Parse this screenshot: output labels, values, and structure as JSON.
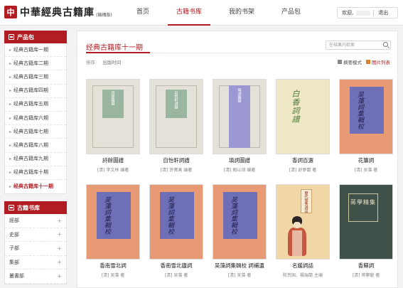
{
  "header": {
    "logo_mark": "中",
    "logo_text": "中華經典古籍庫",
    "logo_sub": "(機構版)",
    "nav": [
      "首页",
      "古籍书库",
      "我的书架",
      "产品包"
    ],
    "active_nav": 1,
    "welcome": "欢迎,",
    "logout": "退出"
  },
  "sidebar": {
    "products_title": "产品包",
    "products": [
      "经典古籍库一期",
      "经典古籍库二期",
      "经典古籍库三期",
      "经典古籍库四期",
      "经典古籍库五期",
      "经典古籍库六期",
      "经典古籍库七期",
      "经典古籍库八期",
      "经典古籍库九期",
      "经典古籍库十期",
      "经典古籍库十一期"
    ],
    "active_product": 10,
    "library_title": "古籍书库",
    "categories": [
      "經部",
      "史部",
      "子部",
      "集部",
      "叢書部"
    ]
  },
  "main": {
    "title": "经典古籍库十一期",
    "search_placeholder": "在结果内检索",
    "sort_label": "排序:",
    "sort_option": "出版时间",
    "view_summary": "摘要模式",
    "view_grid": "图片列表"
  },
  "books": [
    {
      "title": "詩餘圖譜",
      "author": "[清] 李文林 编著",
      "cover": "green",
      "cover_text": "詩餘圖譜"
    },
    {
      "title": "自怡軒詞譜",
      "author": "[清] 許寶善 编著",
      "cover": "green",
      "cover_text": "自怡軒詞譜"
    },
    {
      "title": "填詞圖譜",
      "author": "[清] 賴以邠 编著",
      "cover": "purple",
      "cover_text": "填詞圖譜"
    },
    {
      "title": "香詞百選",
      "author": "[清] 舒夢蘭 著",
      "cover": "calli",
      "cover_text": "白香詞譜"
    },
    {
      "title": "花簾詞",
      "author": "[清] 吴藻 著",
      "cover": "orange",
      "cover_text": "吴藻詞集輯校"
    },
    {
      "title": "香南雪北詞",
      "author": "[清] 吴藻 著",
      "cover": "orange",
      "cover_text": "吴藻詞集輯校"
    },
    {
      "title": "香南雪北廬詞",
      "author": "[清] 吴藻 著",
      "cover": "orange",
      "cover_text": "吴藻詞集輯校"
    },
    {
      "title": "吴藻詞集輯校 詞補遺",
      "author": "[清] 吴藻 著",
      "cover": "orange",
      "cover_text": "吴藻詞集輯校"
    },
    {
      "title": "名媛詞話",
      "author": "陈荒国、楊瑞蘭 主编",
      "cover": "lady",
      "cover_text": "歷代閨秀詞話"
    },
    {
      "title": "香蘇詞",
      "author": "[清] 蒋攀龍 著",
      "cover": "dark",
      "cover_text": "蒋學精集"
    }
  ]
}
